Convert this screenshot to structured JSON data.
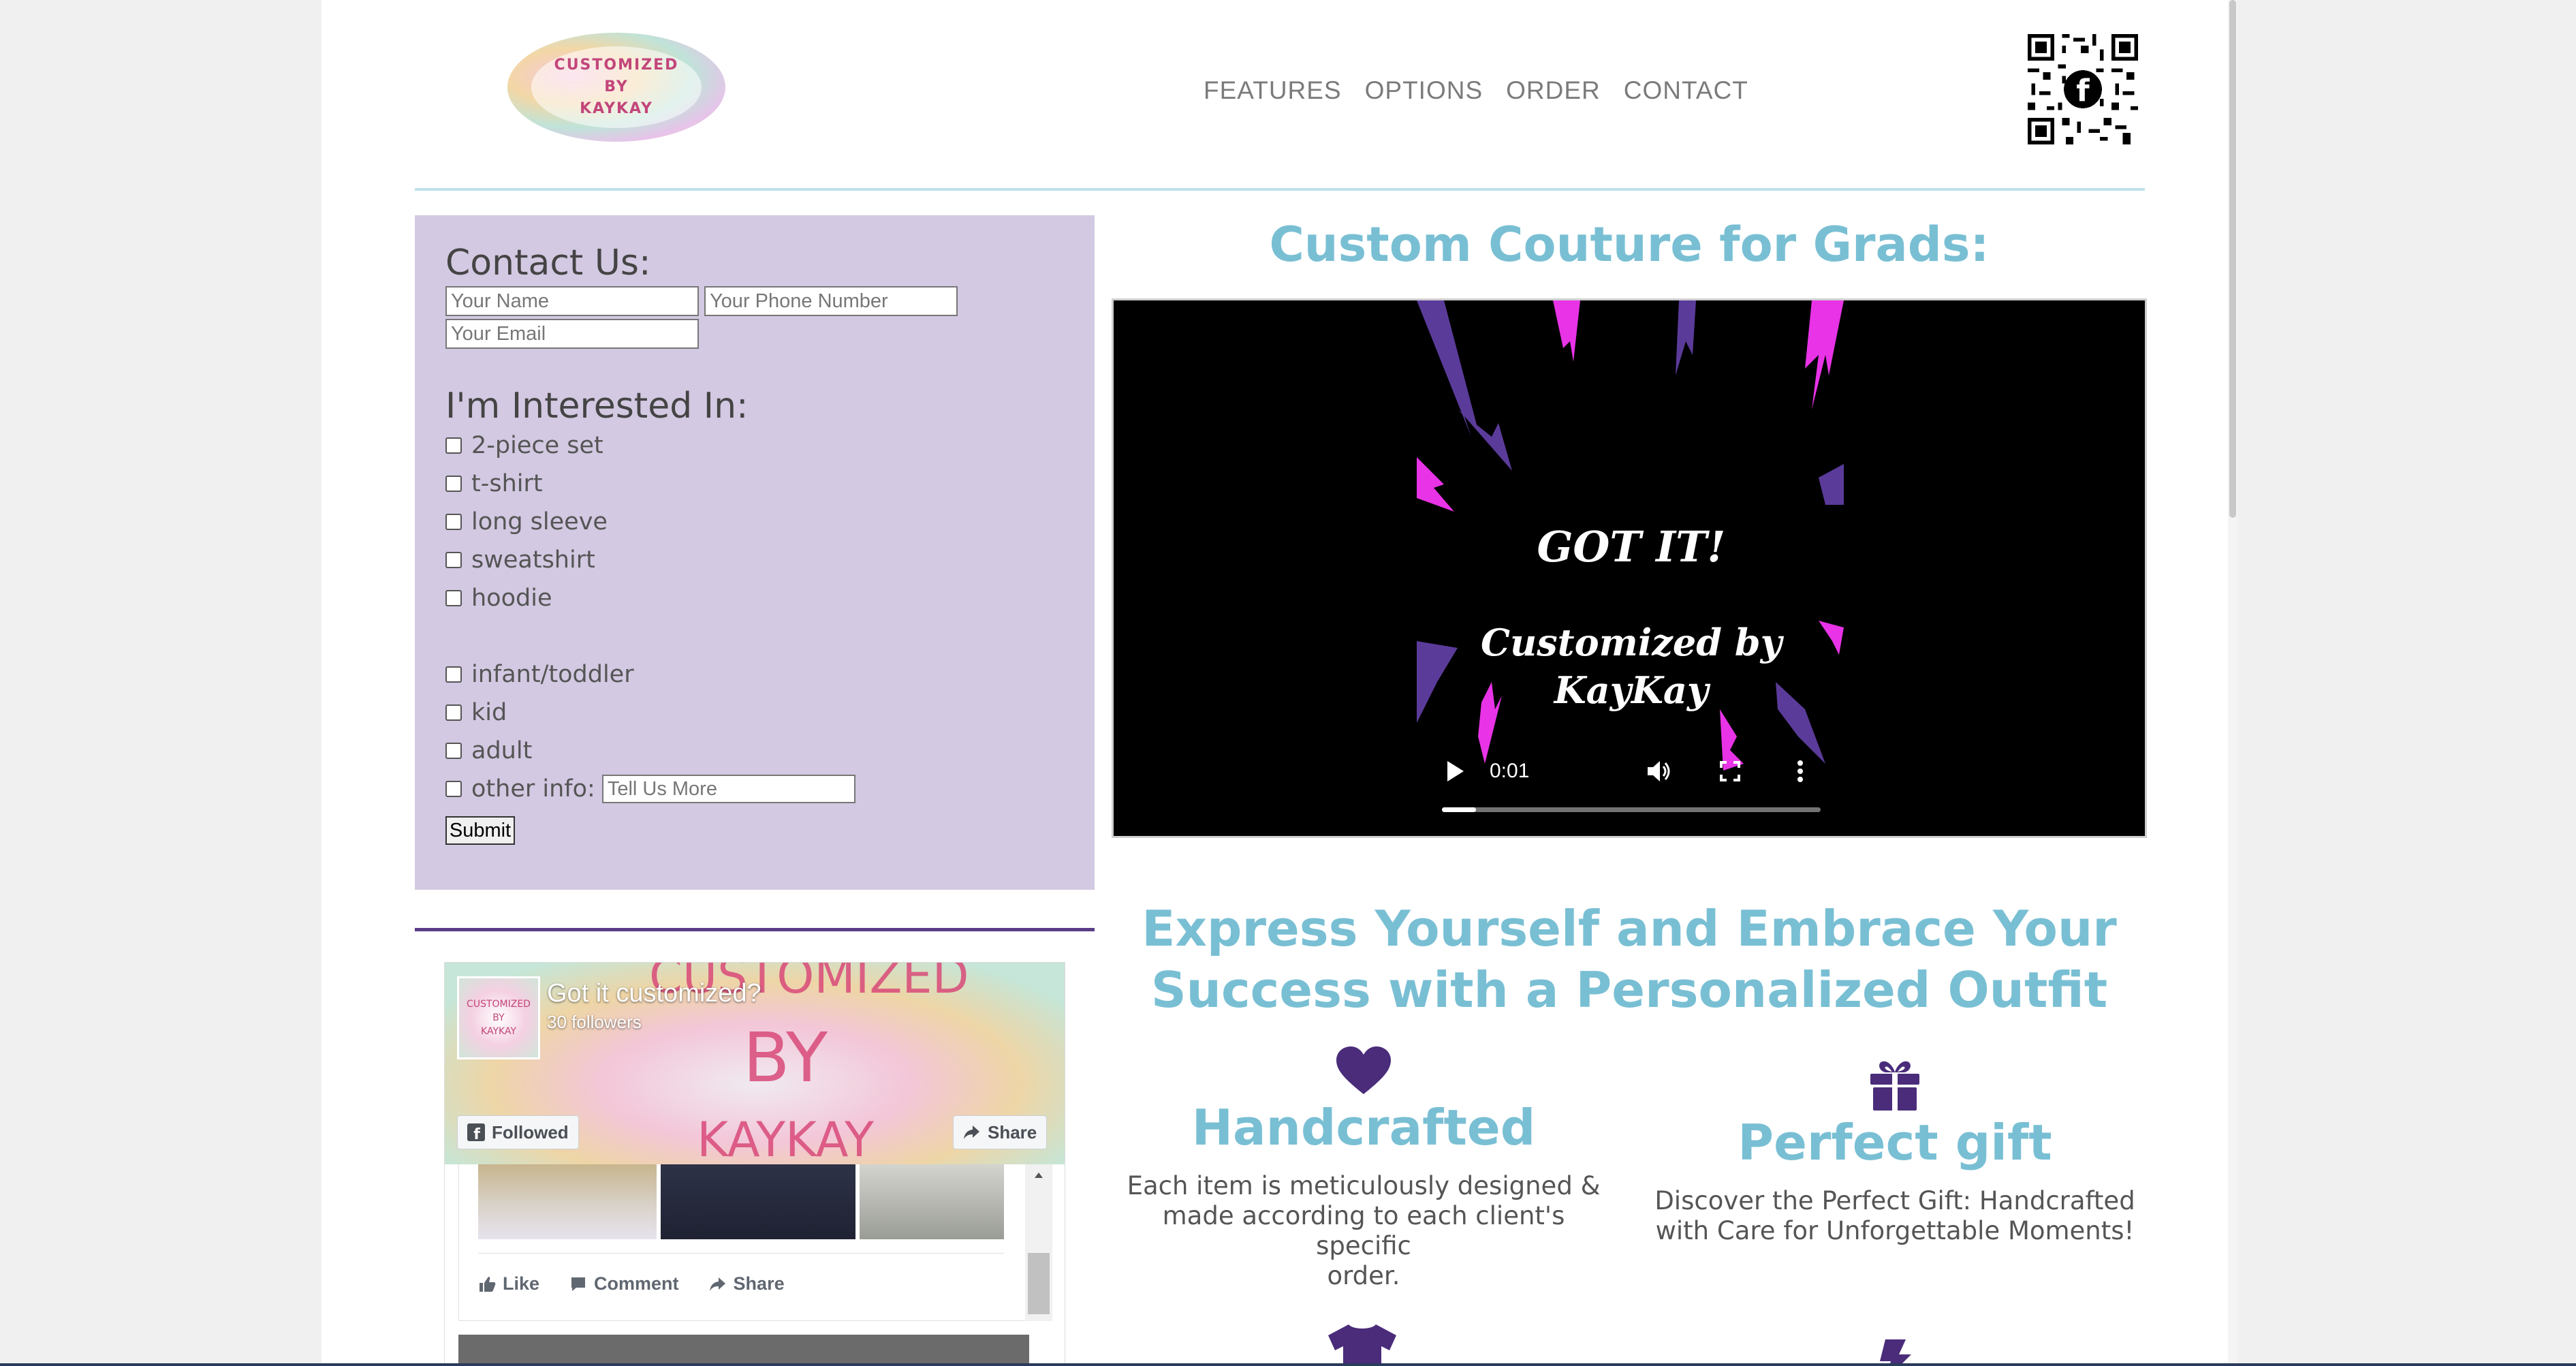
{
  "header": {
    "logo_lines": [
      "CUSTOMIZED",
      "BY",
      "KAYKAY"
    ],
    "nav": [
      "FEATURES",
      "OPTIONS",
      "ORDER",
      "CONTACT"
    ]
  },
  "contact": {
    "title": "Contact Us:",
    "name_placeholder": "Your Name",
    "phone_placeholder": "Your Phone Number",
    "email_placeholder": "Your Email",
    "interest_title": "I'm Interested In:",
    "styles": [
      "2-piece set",
      "t-shirt",
      "long sleeve",
      "sweatshirt",
      "hoodie"
    ],
    "sizes": [
      "infant/toddler",
      "kid",
      "adult"
    ],
    "other_label": "other info:",
    "other_placeholder": "Tell Us More",
    "submit": "Submit"
  },
  "facebook": {
    "cover_text": [
      "CUSTOMIZED",
      "BY",
      "KAYKAY"
    ],
    "page_name": "Got it customized?",
    "followers": "30 followers",
    "followed_btn": "Followed",
    "share_btn": "Share",
    "actions": [
      "Like",
      "Comment",
      "Share"
    ]
  },
  "main": {
    "heading": "Custom Couture for Grads:",
    "video": {
      "title": "GOT IT!",
      "subtitle_1": "Customized by",
      "subtitle_2": "KayKay",
      "time": "0:01",
      "progress": 0.09
    },
    "tagline_1": "Express Yourself and Embrace Your",
    "tagline_2": "Success with a Personalized Outfit",
    "features": [
      {
        "title": "Handcrafted",
        "desc_lines": [
          "Each item is meticulously designed &",
          "made according to each client's specific",
          "order."
        ],
        "icon": "heart-icon"
      },
      {
        "title": "Perfect gift",
        "desc_lines": [
          "Discover the Perfect Gift: Handcrafted",
          "with Care for Unforgettable Moments!"
        ],
        "icon": "gift-icon"
      }
    ]
  },
  "colors": {
    "accent_blue": "#79bfd4",
    "form_bg": "#d3c9e2",
    "icon_purple": "#4a2c7a",
    "video_magenta": "#e833e6",
    "video_violet": "#5b3b9a"
  }
}
